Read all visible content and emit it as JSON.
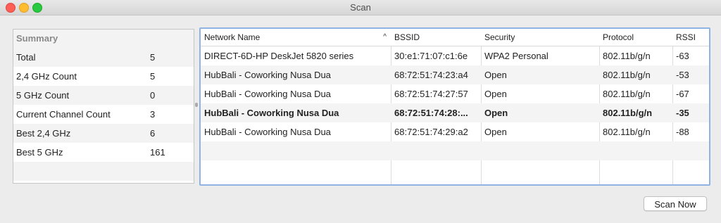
{
  "window": {
    "title": "Scan"
  },
  "summary": {
    "header": "Summary",
    "rows": [
      {
        "label": "Total",
        "value": "5"
      },
      {
        "label": "2,4 GHz Count",
        "value": "5"
      },
      {
        "label": "5 GHz Count",
        "value": "0"
      },
      {
        "label": "Current Channel Count",
        "value": "3"
      },
      {
        "label": "Best 2,4 GHz",
        "value": "6"
      },
      {
        "label": "Best 5 GHz",
        "value": "161"
      }
    ]
  },
  "networks": {
    "columns": [
      "Network Name",
      "BSSID",
      "Security",
      "Protocol",
      "RSSI"
    ],
    "sort_indicator": "^",
    "rows": [
      {
        "name": "DIRECT-6D-HP DeskJet 5820 series",
        "bssid": "30:e1:71:07:c1:6e",
        "security": "WPA2 Personal",
        "protocol": "802.11b/g/n",
        "rssi": "-63"
      },
      {
        "name": "HubBali - Coworking Nusa Dua",
        "bssid": "68:72:51:74:23:a4",
        "security": "Open",
        "protocol": "802.11b/g/n",
        "rssi": "-53"
      },
      {
        "name": "HubBali - Coworking Nusa Dua",
        "bssid": "68:72:51:74:27:57",
        "security": "Open",
        "protocol": "802.11b/g/n",
        "rssi": "-67"
      },
      {
        "name": "HubBali - Coworking Nusa Dua",
        "bssid": "68:72:51:74:28:...",
        "security": "Open",
        "protocol": "802.11b/g/n",
        "rssi": "-35"
      },
      {
        "name": "HubBali - Coworking Nusa Dua",
        "bssid": "68:72:51:74:29:a2",
        "security": "Open",
        "protocol": "802.11b/g/n",
        "rssi": "-88"
      }
    ]
  },
  "actions": {
    "scan_now": "Scan Now"
  }
}
